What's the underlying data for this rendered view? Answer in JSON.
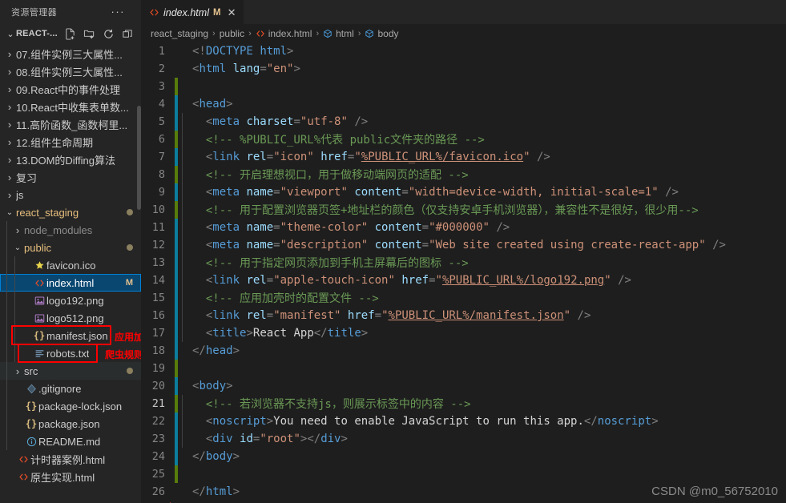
{
  "sidebar": {
    "title": "资源管理器",
    "more_label": "···",
    "root_name": "REACT-...",
    "actions": [
      {
        "name": "new-file-icon",
        "label": "新建文件"
      },
      {
        "name": "new-folder-icon",
        "label": "新建文件夹"
      },
      {
        "name": "refresh-icon",
        "label": "刷新资源管理器"
      },
      {
        "name": "collapse-all-icon",
        "label": "在资源管理器中折叠文件夹"
      }
    ],
    "items": [
      {
        "label": "07.组件实例三大属性...",
        "type": "folder",
        "expanded": false,
        "indent": 1
      },
      {
        "label": "08.组件实例三大属性...",
        "type": "folder",
        "expanded": false,
        "indent": 1
      },
      {
        "label": "09.React中的事件处理",
        "type": "folder",
        "expanded": false,
        "indent": 1
      },
      {
        "label": "10.React中收集表单数...",
        "type": "folder",
        "expanded": false,
        "indent": 1
      },
      {
        "label": "11.高阶函数_函数柯里...",
        "type": "folder",
        "expanded": false,
        "indent": 1
      },
      {
        "label": "12.组件生命周期",
        "type": "folder",
        "expanded": false,
        "indent": 1
      },
      {
        "label": "13.DOM的Diffing算法",
        "type": "folder",
        "expanded": false,
        "indent": 1
      },
      {
        "label": "复习",
        "type": "folder",
        "expanded": false,
        "indent": 1
      },
      {
        "label": "js",
        "type": "folder",
        "expanded": false,
        "indent": 1
      },
      {
        "label": "react_staging",
        "type": "folder",
        "expanded": true,
        "indent": 1,
        "status_dot": true
      },
      {
        "label": "node_modules",
        "type": "folder",
        "expanded": false,
        "indent": 2,
        "dim": true
      },
      {
        "label": "public",
        "type": "folder",
        "expanded": true,
        "indent": 2,
        "status_dot": true
      },
      {
        "label": "favicon.ico",
        "type": "file",
        "icon": "star-icon",
        "indent": 3
      },
      {
        "label": "index.html",
        "type": "file",
        "icon": "html-icon",
        "indent": 3,
        "selected": true,
        "badge": "M"
      },
      {
        "label": "logo192.png",
        "type": "file",
        "icon": "image-icon",
        "indent": 3
      },
      {
        "label": "logo512.png",
        "type": "file",
        "icon": "image-icon",
        "indent": 3
      },
      {
        "label": "manifest.json",
        "type": "file",
        "icon": "json-icon",
        "indent": 3
      },
      {
        "label": "robots.txt",
        "type": "file",
        "icon": "text-icon",
        "indent": 3
      },
      {
        "label": "src",
        "type": "folder",
        "expanded": false,
        "indent": 2,
        "status_dot": true,
        "hl": true
      },
      {
        "label": ".gitignore",
        "type": "file",
        "icon": "git-icon",
        "indent": 2
      },
      {
        "label": "package-lock.json",
        "type": "file",
        "icon": "json-icon",
        "indent": 2
      },
      {
        "label": "package.json",
        "type": "file",
        "icon": "json-icon",
        "indent": 2
      },
      {
        "label": "README.md",
        "type": "file",
        "icon": "info-icon",
        "indent": 2
      },
      {
        "label": "计时器案例.html",
        "type": "file",
        "icon": "html-icon",
        "indent": 1
      },
      {
        "label": "原生实现.html",
        "type": "file",
        "icon": "html-icon",
        "indent": 1
      }
    ],
    "annotations": [
      {
        "name": "manifest-annotation",
        "text": "应用加壳"
      },
      {
        "name": "robots-annotation",
        "text": "爬虫规则"
      }
    ]
  },
  "tab": {
    "name": "index.html",
    "modified_badge": "M",
    "close_label": "✕",
    "icon": "html-icon"
  },
  "breadcrumb": [
    {
      "label": "react_staging",
      "icon": null
    },
    {
      "label": "public",
      "icon": null
    },
    {
      "label": "index.html",
      "icon": "html-icon"
    },
    {
      "label": "html",
      "icon": "symbol-icon"
    },
    {
      "label": "body",
      "icon": "symbol-icon"
    }
  ],
  "breadcrumb_separator": "›",
  "editor": {
    "lines": [
      {
        "n": 1,
        "gutter": "none",
        "guide": false,
        "tokens": [
          {
            "c": "t-br",
            "t": "<!"
          },
          {
            "c": "t-meta",
            "t": "DOCTYPE"
          },
          {
            "c": "t-txt",
            "t": " "
          },
          {
            "c": "t-tag",
            "t": "html"
          },
          {
            "c": "t-br",
            "t": ">"
          }
        ]
      },
      {
        "n": 2,
        "gutter": "none",
        "guide": false,
        "tokens": [
          {
            "c": "t-br",
            "t": "<"
          },
          {
            "c": "t-tag",
            "t": "html"
          },
          {
            "c": "t-txt",
            "t": " "
          },
          {
            "c": "t-attr",
            "t": "lang"
          },
          {
            "c": "t-br",
            "t": "="
          },
          {
            "c": "t-str",
            "t": "\"en\""
          },
          {
            "c": "t-br",
            "t": ">"
          }
        ]
      },
      {
        "n": 3,
        "gutter": "add",
        "guide": false,
        "tokens": []
      },
      {
        "n": 4,
        "gutter": "mod",
        "guide": false,
        "tokens": [
          {
            "c": "t-br",
            "t": "<"
          },
          {
            "c": "t-tag",
            "t": "head"
          },
          {
            "c": "t-br",
            "t": ">"
          }
        ]
      },
      {
        "n": 5,
        "gutter": "mod",
        "guide": true,
        "tokens": [
          {
            "c": "t-br",
            "t": "  <"
          },
          {
            "c": "t-tag",
            "t": "meta"
          },
          {
            "c": "t-txt",
            "t": " "
          },
          {
            "c": "t-attr",
            "t": "charset"
          },
          {
            "c": "t-br",
            "t": "="
          },
          {
            "c": "t-str",
            "t": "\"utf-8\""
          },
          {
            "c": "t-br",
            "t": " />"
          }
        ]
      },
      {
        "n": 6,
        "gutter": "add",
        "guide": true,
        "tokens": [
          {
            "c": "t-com",
            "t": "  <!-- %PUBLIC_URL%代表 public文件夹的路径 -->"
          }
        ]
      },
      {
        "n": 7,
        "gutter": "mod",
        "guide": true,
        "tokens": [
          {
            "c": "t-br",
            "t": "  <"
          },
          {
            "c": "t-tag",
            "t": "link"
          },
          {
            "c": "t-txt",
            "t": " "
          },
          {
            "c": "t-attr",
            "t": "rel"
          },
          {
            "c": "t-br",
            "t": "="
          },
          {
            "c": "t-str",
            "t": "\"icon\""
          },
          {
            "c": "t-txt",
            "t": " "
          },
          {
            "c": "t-attr",
            "t": "href"
          },
          {
            "c": "t-br",
            "t": "="
          },
          {
            "c": "t-str",
            "t": "\""
          },
          {
            "c": "t-link",
            "t": "%PUBLIC_URL%/favicon.ico"
          },
          {
            "c": "t-str",
            "t": "\""
          },
          {
            "c": "t-br",
            "t": " />"
          }
        ]
      },
      {
        "n": 8,
        "gutter": "add",
        "guide": true,
        "tokens": [
          {
            "c": "t-com",
            "t": "  <!-- 开启理想视口，用于做移动端网页的适配 -->"
          }
        ]
      },
      {
        "n": 9,
        "gutter": "mod",
        "guide": true,
        "tokens": [
          {
            "c": "t-br",
            "t": "  <"
          },
          {
            "c": "t-tag",
            "t": "meta"
          },
          {
            "c": "t-txt",
            "t": " "
          },
          {
            "c": "t-attr",
            "t": "name"
          },
          {
            "c": "t-br",
            "t": "="
          },
          {
            "c": "t-str",
            "t": "\"viewport\""
          },
          {
            "c": "t-txt",
            "t": " "
          },
          {
            "c": "t-attr",
            "t": "content"
          },
          {
            "c": "t-br",
            "t": "="
          },
          {
            "c": "t-str",
            "t": "\"width=device-width, initial-scale=1\""
          },
          {
            "c": "t-br",
            "t": " />"
          }
        ]
      },
      {
        "n": 10,
        "gutter": "add",
        "guide": true,
        "tokens": [
          {
            "c": "t-com",
            "t": "  <!-- 用于配置浏览器页签+地址栏的颜色（仅支持安卓手机浏览器），兼容性不是很好，很少用-->"
          }
        ]
      },
      {
        "n": 11,
        "gutter": "mod",
        "guide": true,
        "tokens": [
          {
            "c": "t-br",
            "t": "  <"
          },
          {
            "c": "t-tag",
            "t": "meta"
          },
          {
            "c": "t-txt",
            "t": " "
          },
          {
            "c": "t-attr",
            "t": "name"
          },
          {
            "c": "t-br",
            "t": "="
          },
          {
            "c": "t-str",
            "t": "\"theme-color\""
          },
          {
            "c": "t-txt",
            "t": " "
          },
          {
            "c": "t-attr",
            "t": "content"
          },
          {
            "c": "t-br",
            "t": "="
          },
          {
            "c": "t-str",
            "t": "\"#000000\""
          },
          {
            "c": "t-br",
            "t": " />"
          }
        ]
      },
      {
        "n": 12,
        "gutter": "mod",
        "guide": true,
        "tokens": [
          {
            "c": "t-br",
            "t": "  <"
          },
          {
            "c": "t-tag",
            "t": "meta"
          },
          {
            "c": "t-txt",
            "t": " "
          },
          {
            "c": "t-attr",
            "t": "name"
          },
          {
            "c": "t-br",
            "t": "="
          },
          {
            "c": "t-str",
            "t": "\"description\""
          },
          {
            "c": "t-txt",
            "t": " "
          },
          {
            "c": "t-attr",
            "t": "content"
          },
          {
            "c": "t-br",
            "t": "="
          },
          {
            "c": "t-str",
            "t": "\"Web site created using create-react-app\""
          },
          {
            "c": "t-br",
            "t": " />"
          }
        ]
      },
      {
        "n": 13,
        "gutter": "mod",
        "guide": true,
        "tokens": [
          {
            "c": "t-com",
            "t": "  <!-- 用于指定网页添加到手机主屏幕后的图标 -->"
          }
        ]
      },
      {
        "n": 14,
        "gutter": "mod",
        "guide": true,
        "tokens": [
          {
            "c": "t-br",
            "t": "  <"
          },
          {
            "c": "t-tag",
            "t": "link"
          },
          {
            "c": "t-txt",
            "t": " "
          },
          {
            "c": "t-attr",
            "t": "rel"
          },
          {
            "c": "t-br",
            "t": "="
          },
          {
            "c": "t-str",
            "t": "\"apple-touch-icon\""
          },
          {
            "c": "t-txt",
            "t": " "
          },
          {
            "c": "t-attr",
            "t": "href"
          },
          {
            "c": "t-br",
            "t": "="
          },
          {
            "c": "t-str",
            "t": "\""
          },
          {
            "c": "t-link",
            "t": "%PUBLIC_URL%/logo192.png"
          },
          {
            "c": "t-str",
            "t": "\""
          },
          {
            "c": "t-br",
            "t": " />"
          }
        ]
      },
      {
        "n": 15,
        "gutter": "mod",
        "guide": true,
        "tokens": [
          {
            "c": "t-com",
            "t": "  <!-- 应用加壳时的配置文件 -->"
          }
        ]
      },
      {
        "n": 16,
        "gutter": "mod",
        "guide": true,
        "tokens": [
          {
            "c": "t-br",
            "t": "  <"
          },
          {
            "c": "t-tag",
            "t": "link"
          },
          {
            "c": "t-txt",
            "t": " "
          },
          {
            "c": "t-attr",
            "t": "rel"
          },
          {
            "c": "t-br",
            "t": "="
          },
          {
            "c": "t-str",
            "t": "\"manifest\""
          },
          {
            "c": "t-txt",
            "t": " "
          },
          {
            "c": "t-attr",
            "t": "href"
          },
          {
            "c": "t-br",
            "t": "="
          },
          {
            "c": "t-str",
            "t": "\""
          },
          {
            "c": "t-link",
            "t": "%PUBLIC_URL%/manifest.json"
          },
          {
            "c": "t-str",
            "t": "\""
          },
          {
            "c": "t-br",
            "t": " />"
          }
        ]
      },
      {
        "n": 17,
        "gutter": "mod",
        "guide": true,
        "tokens": [
          {
            "c": "t-br",
            "t": "  <"
          },
          {
            "c": "t-tag",
            "t": "title"
          },
          {
            "c": "t-br",
            "t": ">"
          },
          {
            "c": "t-txt",
            "t": "React App"
          },
          {
            "c": "t-br",
            "t": "</"
          },
          {
            "c": "t-tag",
            "t": "title"
          },
          {
            "c": "t-br",
            "t": ">"
          }
        ]
      },
      {
        "n": 18,
        "gutter": "mod",
        "guide": false,
        "tokens": [
          {
            "c": "t-br",
            "t": "</"
          },
          {
            "c": "t-tag",
            "t": "head"
          },
          {
            "c": "t-br",
            "t": ">"
          }
        ]
      },
      {
        "n": 19,
        "gutter": "add",
        "guide": false,
        "tokens": []
      },
      {
        "n": 20,
        "gutter": "mod",
        "guide": false,
        "tokens": [
          {
            "c": "t-br",
            "t": "<"
          },
          {
            "c": "t-tag",
            "t": "body"
          },
          {
            "c": "t-br",
            "t": ">"
          }
        ]
      },
      {
        "n": 21,
        "gutter": "add",
        "guide": true,
        "active": true,
        "tokens": [
          {
            "c": "t-com",
            "t": "  <!-- 若浏览器不支持js，则展示标签中的内容 -->"
          }
        ]
      },
      {
        "n": 22,
        "gutter": "mod",
        "guide": true,
        "tokens": [
          {
            "c": "t-br",
            "t": "  <"
          },
          {
            "c": "t-tag",
            "t": "noscript"
          },
          {
            "c": "t-br",
            "t": ">"
          },
          {
            "c": "t-txt",
            "t": "You need to enable JavaScript to run this app."
          },
          {
            "c": "t-br",
            "t": "</"
          },
          {
            "c": "t-tag",
            "t": "noscript"
          },
          {
            "c": "t-br",
            "t": ">"
          }
        ]
      },
      {
        "n": 23,
        "gutter": "mod",
        "guide": true,
        "tokens": [
          {
            "c": "t-br",
            "t": "  <"
          },
          {
            "c": "t-tag",
            "t": "div"
          },
          {
            "c": "t-txt",
            "t": " "
          },
          {
            "c": "t-attr",
            "t": "id"
          },
          {
            "c": "t-br",
            "t": "="
          },
          {
            "c": "t-str",
            "t": "\"root\""
          },
          {
            "c": "t-br",
            "t": "></"
          },
          {
            "c": "t-tag",
            "t": "div"
          },
          {
            "c": "t-br",
            "t": ">"
          }
        ]
      },
      {
        "n": 24,
        "gutter": "mod",
        "guide": false,
        "tokens": [
          {
            "c": "t-br",
            "t": "</"
          },
          {
            "c": "t-tag",
            "t": "body"
          },
          {
            "c": "t-br",
            "t": ">"
          }
        ]
      },
      {
        "n": 25,
        "gutter": "add",
        "guide": false,
        "tokens": []
      },
      {
        "n": 26,
        "gutter": "none",
        "guide": false,
        "tokens": [
          {
            "c": "t-br",
            "t": "</"
          },
          {
            "c": "t-tag",
            "t": "html"
          },
          {
            "c": "t-br",
            "t": ">"
          }
        ]
      }
    ]
  },
  "watermark": "CSDN @m0_56752010",
  "colors": {
    "editor_bg": "#1e1e1e",
    "sidebar_bg": "#252526",
    "selection": "#094771",
    "selection_border": "#007fd4",
    "badge": "#e2c08d",
    "annotation_red": "#ff0000",
    "git_add": "#587c0c",
    "git_mod": "#0c7d9d"
  }
}
